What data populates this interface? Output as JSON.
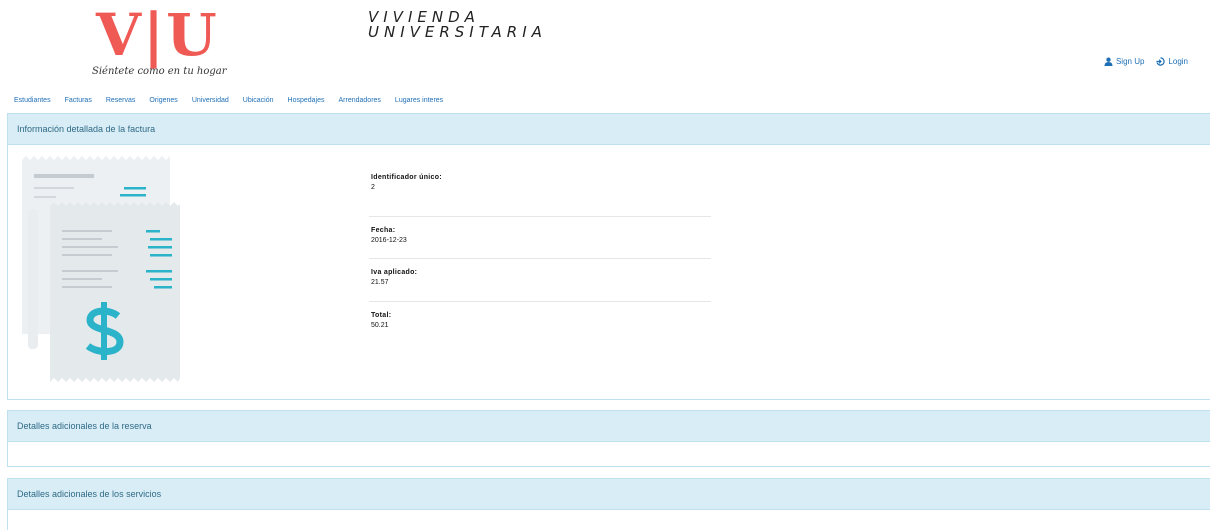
{
  "brand": {
    "logo_text": "V|U",
    "tagline": "Siéntete como en tu hogar",
    "line1": "VIVIENDA",
    "line2": "UNIVERSITARIA"
  },
  "auth": {
    "signup": "Sign Up",
    "login": "Login"
  },
  "nav": [
    "Estudiantes",
    "Facturas",
    "Reservas",
    "Origenes",
    "Universidad",
    "Ubicación",
    "Hospedajes",
    "Arrendadores",
    "Lugares interes"
  ],
  "invoice_panel": {
    "title": "Información detallada de la factura",
    "fields": [
      {
        "label": "Identificador único:",
        "value": "2"
      },
      {
        "label": "Fecha:",
        "value": "2016-12-23"
      },
      {
        "label": "Iva aplicado:",
        "value": "21.57"
      },
      {
        "label": "Total:",
        "value": "50.21"
      }
    ]
  },
  "reserva_panel": {
    "title": "Detalles adicionales de la reserva"
  },
  "servicios_panel": {
    "title": "Detalles adicionales de los servicios"
  },
  "colors": {
    "logo_red": "#ef5a55",
    "link_blue": "#1f6fb6",
    "panel_head": "#d9edf6",
    "accent_teal": "#2bb3c9"
  }
}
